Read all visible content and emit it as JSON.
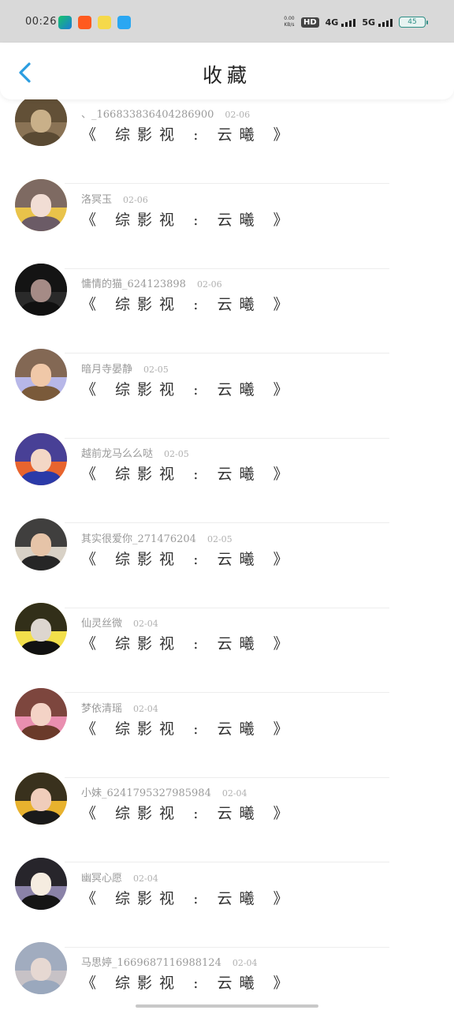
{
  "status_bar": {
    "time": "00:26",
    "speed": "0.00\nKB/s",
    "hd_badge": "HD",
    "net1": "4G",
    "net2": "5G",
    "battery": "45"
  },
  "header": {
    "title": "收藏"
  },
  "items": [
    {
      "name": "、_166833836404286900",
      "date": "02-06",
      "title": "《 综影视 : 云曦 》",
      "avatar_colors": [
        "#5a4a33",
        "#c9b089",
        "#8a7355"
      ]
    },
    {
      "name": "洛冥玉",
      "date": "02-06",
      "title": "《 综影视 : 云曦 》",
      "avatar_colors": [
        "#6b5b66",
        "#f1ddd4",
        "#e9c34a"
      ]
    },
    {
      "name": "慵情的猫_624123898",
      "date": "02-06",
      "title": "《 综影视 : 云曦 》",
      "avatar_colors": [
        "#111111",
        "#a58b86",
        "#2a2a2a"
      ]
    },
    {
      "name": "暗月寺晏静",
      "date": "02-05",
      "title": "《 综影视 : 云曦 》",
      "avatar_colors": [
        "#7a5a3a",
        "#f0c8a8",
        "#b7b7e8"
      ]
    },
    {
      "name": "越前龙马么么哒",
      "date": "02-05",
      "title": "《 综影视 : 云曦 》",
      "avatar_colors": [
        "#2b3aa8",
        "#f3d7c6",
        "#e8642e"
      ]
    },
    {
      "name": "其实很爱你_271476204",
      "date": "02-05",
      "title": "《 综影视 : 云曦 》",
      "avatar_colors": [
        "#262626",
        "#e6c4a8",
        "#d8d1c6"
      ]
    },
    {
      "name": "仙灵丝微",
      "date": "02-04",
      "title": "《 综影视 : 云曦 》",
      "avatar_colors": [
        "#111111",
        "#ddd6cf",
        "#f2df4b"
      ]
    },
    {
      "name": "梦依清瑶",
      "date": "02-04",
      "title": "《 综影视 : 云曦 》",
      "avatar_colors": [
        "#6a3a2a",
        "#f4d3c6",
        "#e98fb0"
      ]
    },
    {
      "name": "小妹_6241795327985984",
      "date": "02-04",
      "title": "《 综影视 : 云曦 》",
      "avatar_colors": [
        "#1a1a1a",
        "#f0cdbb",
        "#e8b22e"
      ]
    },
    {
      "name": "幽冥心愿",
      "date": "02-04",
      "title": "《 综影视 : 云曦 》",
      "avatar_colors": [
        "#151515",
        "#f5ece0",
        "#8a82a8"
      ]
    },
    {
      "name": "马思婷_1669687116988124",
      "date": "02-04",
      "title": "《 综影视 : 云曦 》",
      "avatar_colors": [
        "#9aa8bd",
        "#e6d8d2",
        "#c7c2c6"
      ]
    }
  ]
}
